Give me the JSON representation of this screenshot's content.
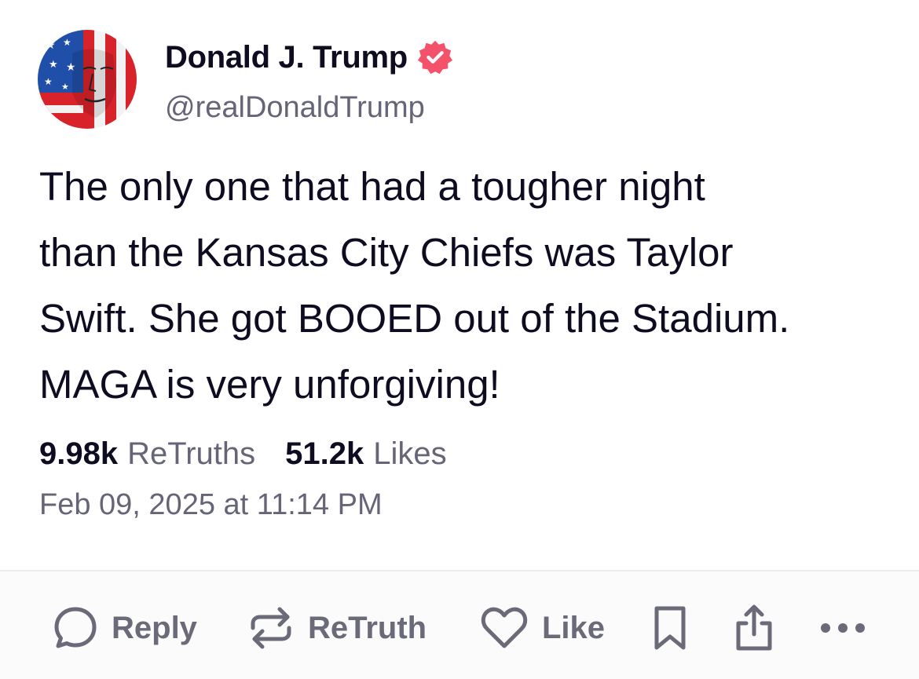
{
  "post": {
    "display_name": "Donald J. Trump",
    "handle": "@realDonaldTrump",
    "verified_icon": "verified-badge-icon",
    "avatar_icon": "profile-avatar-icon",
    "body_lines": [
      "The only one that had a tougher night",
      "than the Kansas City Chiefs was Taylor",
      "Swift. She got BOOED out of the Stadium.",
      "MAGA is very unforgiving!"
    ],
    "stats": {
      "retruths_count": "9.98k",
      "retruths_label": "ReTruths",
      "likes_count": "51.2k",
      "likes_label": "Likes"
    },
    "timestamp": "Feb 09, 2025 at 11:14 PM"
  },
  "actions": {
    "reply_label": "Reply",
    "retruth_label": "ReTruth",
    "like_label": "Like",
    "icons": [
      "reply-icon",
      "retruth-icon",
      "like-icon",
      "bookmark-icon",
      "share-icon",
      "more-icon"
    ]
  },
  "colors": {
    "text_primary": "#0e0c21",
    "text_secondary": "#666577",
    "verified_badge": "#f4526b",
    "action_gray": "#6a6a78",
    "divider": "#ececf0"
  }
}
